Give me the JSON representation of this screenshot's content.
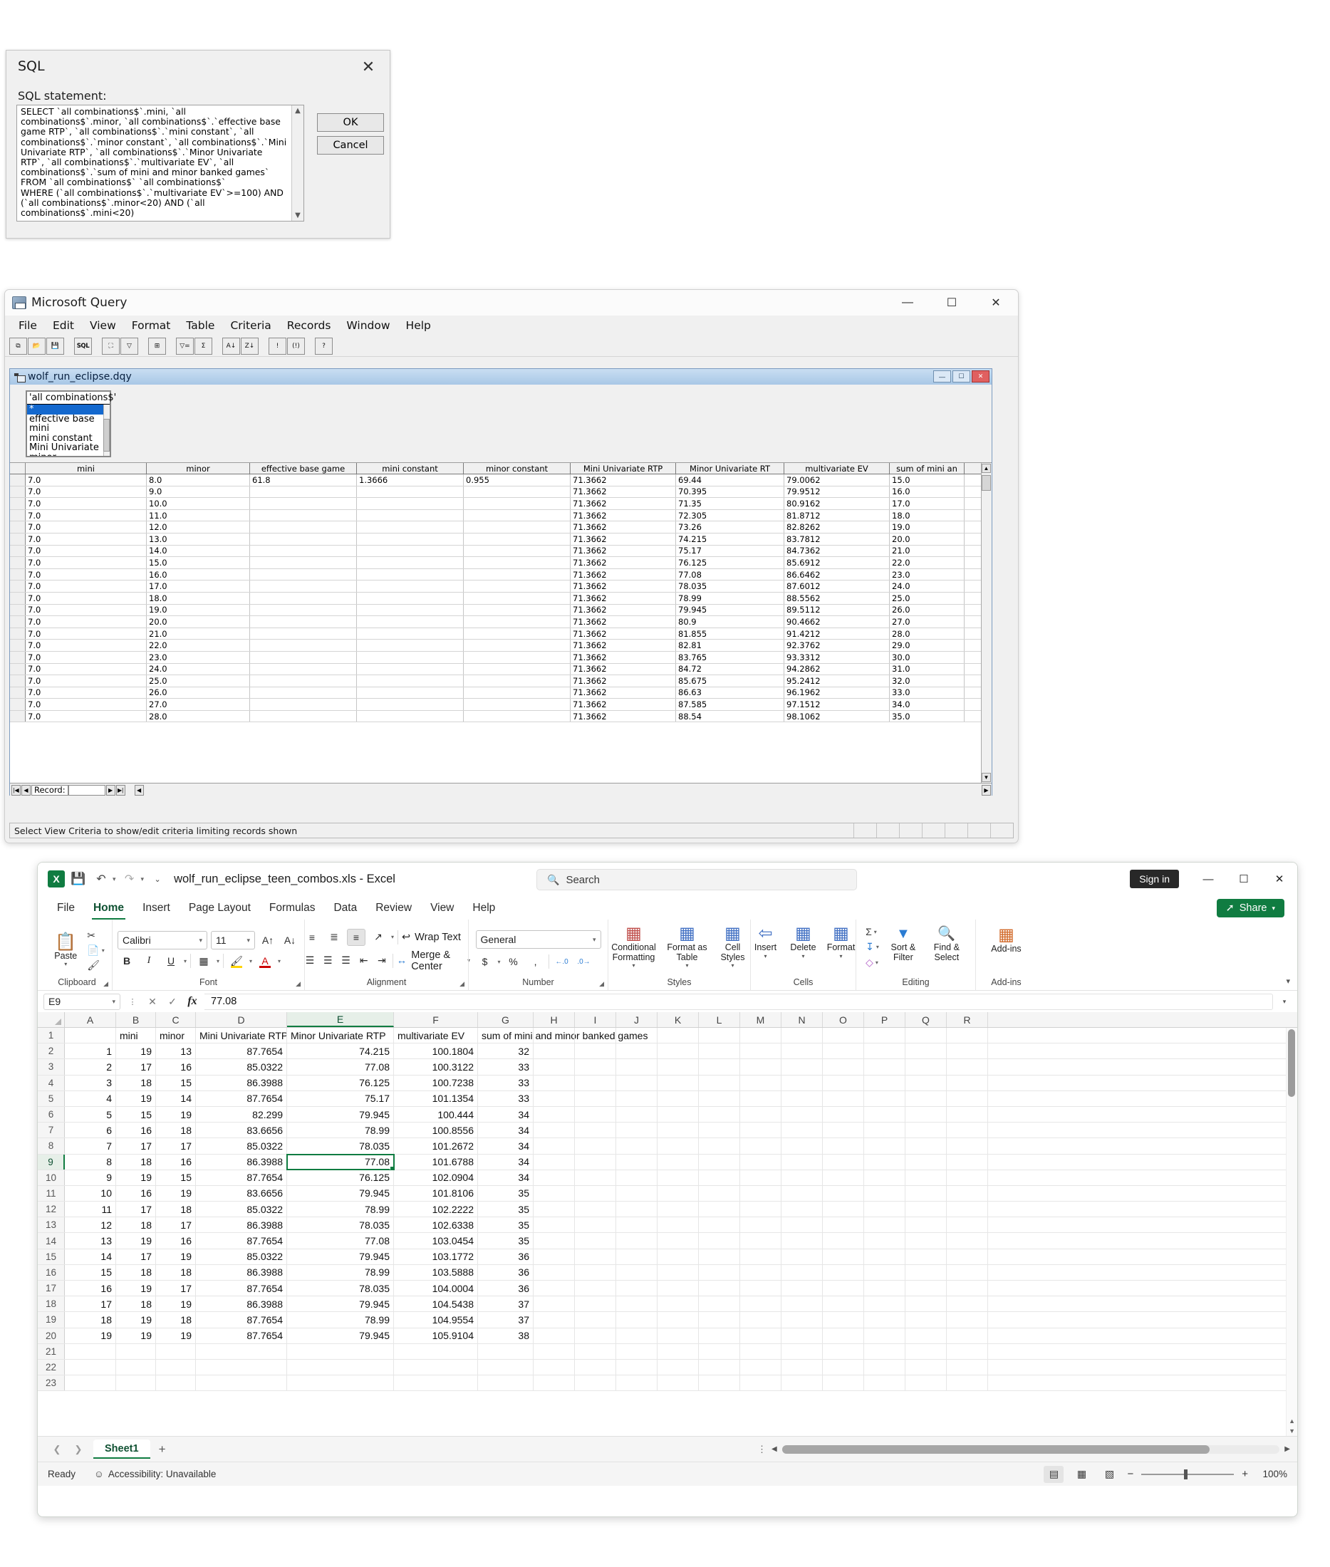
{
  "sql_dialog": {
    "title": "SQL",
    "close_icon": "close-icon",
    "statement_label": "SQL statement:",
    "statement": "SELECT `all combinations$`.mini, `all combinations$`.minor, `all combinations$`.`effective base game RTP`, `all combinations$`.`mini constant`, `all combinations$`.`minor constant`, `all combinations$`.`Mini Univariate RTP`, `all combinations$`.`Minor Univariate RTP`, `all combinations$`.`multivariate EV`, `all combinations$`.`sum of mini and minor banked games`\nFROM `all combinations$` `all combinations$`\nWHERE (`all combinations$`.`multivariate EV`>=100) AND (`all combinations$`.minor<20) AND (`all combinations$`.mini<20)",
    "ok_label": "OK",
    "cancel_label": "Cancel"
  },
  "msquery": {
    "title": "Microsoft Query",
    "menus": [
      "File",
      "Edit",
      "View",
      "Format",
      "Table",
      "Criteria",
      "Records",
      "Window",
      "Help"
    ],
    "toolbar": [
      {
        "name": "new-query-icon",
        "glyph": "⧉"
      },
      {
        "name": "open-query-icon",
        "glyph": "📂"
      },
      {
        "name": "save-query-icon",
        "glyph": "💾"
      },
      {
        "name": "sql-view-icon",
        "glyph": "SQL"
      },
      {
        "name": "show-tables-icon",
        "glyph": "⛶"
      },
      {
        "name": "show-criteria-icon",
        "glyph": "▽"
      },
      {
        "name": "add-table-icon",
        "glyph": "⊞"
      },
      {
        "name": "criteria-equals-icon",
        "glyph": "▽="
      },
      {
        "name": "cycle-totals-icon",
        "glyph": "Σ"
      },
      {
        "name": "sort-ascending-icon",
        "glyph": "A↓"
      },
      {
        "name": "sort-descending-icon",
        "glyph": "Z↓"
      },
      {
        "name": "query-now-icon",
        "glyph": "!"
      },
      {
        "name": "auto-query-icon",
        "glyph": "(!)"
      },
      {
        "name": "help-icon",
        "glyph": "?"
      }
    ],
    "window_buttons": {
      "minimize": "—",
      "maximize": "☐",
      "close": "✕"
    },
    "child_window": {
      "title": "wolf_run_eclipse.dqy",
      "buttons": {
        "minimize": "—",
        "maximize": "☐",
        "close": "✕"
      },
      "table_box": {
        "title": "'all combinations$'",
        "fields": [
          "*",
          "effective base",
          "mini",
          "mini constant",
          "Mini Univariate",
          "minor"
        ],
        "selected_index": 0
      },
      "grid": {
        "columns": [
          "mini",
          "minor",
          "effective base game",
          "mini constant",
          "minor constant",
          "Mini Univariate RTP",
          "Minor Univariate RT",
          "multivariate EV",
          "sum of mini an"
        ],
        "rows": [
          [
            "7.0",
            "8.0",
            "61.8",
            "1.3666",
            "0.955",
            "71.3662",
            "69.44",
            "79.0062",
            "15.0"
          ],
          [
            "7.0",
            "9.0",
            "",
            "",
            "",
            "71.3662",
            "70.395",
            "79.9512",
            "16.0"
          ],
          [
            "7.0",
            "10.0",
            "",
            "",
            "",
            "71.3662",
            "71.35",
            "80.9162",
            "17.0"
          ],
          [
            "7.0",
            "11.0",
            "",
            "",
            "",
            "71.3662",
            "72.305",
            "81.8712",
            "18.0"
          ],
          [
            "7.0",
            "12.0",
            "",
            "",
            "",
            "71.3662",
            "73.26",
            "82.8262",
            "19.0"
          ],
          [
            "7.0",
            "13.0",
            "",
            "",
            "",
            "71.3662",
            "74.215",
            "83.7812",
            "20.0"
          ],
          [
            "7.0",
            "14.0",
            "",
            "",
            "",
            "71.3662",
            "75.17",
            "84.7362",
            "21.0"
          ],
          [
            "7.0",
            "15.0",
            "",
            "",
            "",
            "71.3662",
            "76.125",
            "85.6912",
            "22.0"
          ],
          [
            "7.0",
            "16.0",
            "",
            "",
            "",
            "71.3662",
            "77.08",
            "86.6462",
            "23.0"
          ],
          [
            "7.0",
            "17.0",
            "",
            "",
            "",
            "71.3662",
            "78.035",
            "87.6012",
            "24.0"
          ],
          [
            "7.0",
            "18.0",
            "",
            "",
            "",
            "71.3662",
            "78.99",
            "88.5562",
            "25.0"
          ],
          [
            "7.0",
            "19.0",
            "",
            "",
            "",
            "71.3662",
            "79.945",
            "89.5112",
            "26.0"
          ],
          [
            "7.0",
            "20.0",
            "",
            "",
            "",
            "71.3662",
            "80.9",
            "90.4662",
            "27.0"
          ],
          [
            "7.0",
            "21.0",
            "",
            "",
            "",
            "71.3662",
            "81.855",
            "91.4212",
            "28.0"
          ],
          [
            "7.0",
            "22.0",
            "",
            "",
            "",
            "71.3662",
            "82.81",
            "92.3762",
            "29.0"
          ],
          [
            "7.0",
            "23.0",
            "",
            "",
            "",
            "71.3662",
            "83.765",
            "93.3312",
            "30.0"
          ],
          [
            "7.0",
            "24.0",
            "",
            "",
            "",
            "71.3662",
            "84.72",
            "94.2862",
            "31.0"
          ],
          [
            "7.0",
            "25.0",
            "",
            "",
            "",
            "71.3662",
            "85.675",
            "95.2412",
            "32.0"
          ],
          [
            "7.0",
            "26.0",
            "",
            "",
            "",
            "71.3662",
            "86.63",
            "96.1962",
            "33.0"
          ],
          [
            "7.0",
            "27.0",
            "",
            "",
            "",
            "71.3662",
            "87.585",
            "97.1512",
            "34.0"
          ],
          [
            "7.0",
            "28.0",
            "",
            "",
            "",
            "71.3662",
            "88.54",
            "98.1062",
            "35.0"
          ]
        ]
      },
      "record_nav": {
        "label": "Record:"
      }
    },
    "statusbar": "Select View Criteria to show/edit criteria limiting records shown"
  },
  "excel": {
    "document_title": "wolf_run_eclipse_teen_combos.xls  -  Excel",
    "logo_text": "X",
    "quick_access": [
      {
        "name": "save-icon",
        "glyph": "💾"
      },
      {
        "name": "undo-icon",
        "glyph": "↶"
      },
      {
        "name": "redo-icon",
        "glyph": "↷"
      },
      {
        "name": "customize-quick-access-icon",
        "glyph": "⌄"
      }
    ],
    "search": {
      "placeholder": "Search",
      "icon": "search-icon"
    },
    "sign_in_label": "Sign in",
    "window_buttons": {
      "minimize": "—",
      "maximize": "☐",
      "close": "✕"
    },
    "tabs": [
      "File",
      "Home",
      "Insert",
      "Page Layout",
      "Formulas",
      "Data",
      "Review",
      "View",
      "Help"
    ],
    "active_tab": "Home",
    "share_label": "Share",
    "ribbon": {
      "clipboard": {
        "label": "Clipboard",
        "paste_label": "Paste",
        "cut_icon": "scissors-icon",
        "copy_icon": "copy-icon",
        "format_painter_icon": "format-painter-icon"
      },
      "font": {
        "label": "Font",
        "font_name": "Calibri",
        "font_size": "11",
        "grow_icon": "increase-font-size-icon",
        "shrink_icon": "decrease-font-size-icon",
        "bold": "B",
        "italic": "I",
        "underline": "U",
        "borders_icon": "borders-icon",
        "fill_color_icon": "fill-color-icon",
        "font_color_icon": "font-color-icon"
      },
      "alignment": {
        "label": "Alignment",
        "wrap_text_label": "Wrap Text",
        "merge_center_label": "Merge & Center",
        "orientation_icon": "text-orientation-icon"
      },
      "number": {
        "label": "Number",
        "format": "General",
        "currency_icon": "currency-icon",
        "percent_icon": "percent-style-icon",
        "comma_icon": "comma-style-icon",
        "increase_decimal_icon": "increase-decimal-icon",
        "decrease_decimal_icon": "decrease-decimal-icon"
      },
      "styles": {
        "label": "Styles",
        "conditional_formatting": "Conditional\nFormatting",
        "format_as_table": "Format as\nTable",
        "cell_styles": "Cell\nStyles"
      },
      "cells": {
        "label": "Cells",
        "insert": "Insert",
        "delete": "Delete",
        "format": "Format"
      },
      "editing": {
        "label": "Editing",
        "autosum_icon": "autosum-icon",
        "fill_icon": "fill-icon",
        "clear_icon": "clear-icon",
        "sort_filter": "Sort &\nFilter",
        "find_select": "Find &\nSelect"
      },
      "addins": {
        "label": "Add-ins",
        "button_label": "Add-ins"
      }
    },
    "formula_bar": {
      "name_box": "E9",
      "cancel_icon": "cancel-entry-icon",
      "enter_icon": "confirm-entry-icon",
      "fx_icon": "insert-function-icon",
      "value": "77.08"
    },
    "sheet": {
      "columns": [
        "A",
        "B",
        "C",
        "D",
        "E",
        "F",
        "G",
        "H",
        "I",
        "J",
        "K",
        "L",
        "M",
        "N",
        "O",
        "P",
        "Q",
        "R"
      ],
      "selected_column": "E",
      "selected_row": 9,
      "active_cell": "E9",
      "header_row": {
        "row": 1,
        "cells": {
          "B": "mini",
          "C": "minor",
          "D": "Mini Univariate RTP",
          "E": "Minor Univariate RTP",
          "F": "multivariate EV",
          "G": "sum of mini and minor banked games"
        }
      },
      "rows": [
        {
          "row": 2,
          "A": "1",
          "B": "19",
          "C": "13",
          "D": "87.7654",
          "E": "74.215",
          "F": "100.1804",
          "G": "32"
        },
        {
          "row": 3,
          "A": "2",
          "B": "17",
          "C": "16",
          "D": "85.0322",
          "E": "77.08",
          "F": "100.3122",
          "G": "33"
        },
        {
          "row": 4,
          "A": "3",
          "B": "18",
          "C": "15",
          "D": "86.3988",
          "E": "76.125",
          "F": "100.7238",
          "G": "33"
        },
        {
          "row": 5,
          "A": "4",
          "B": "19",
          "C": "14",
          "D": "87.7654",
          "E": "75.17",
          "F": "101.1354",
          "G": "33"
        },
        {
          "row": 6,
          "A": "5",
          "B": "15",
          "C": "19",
          "D": "82.299",
          "E": "79.945",
          "F": "100.444",
          "G": "34"
        },
        {
          "row": 7,
          "A": "6",
          "B": "16",
          "C": "18",
          "D": "83.6656",
          "E": "78.99",
          "F": "100.8556",
          "G": "34"
        },
        {
          "row": 8,
          "A": "7",
          "B": "17",
          "C": "17",
          "D": "85.0322",
          "E": "78.035",
          "F": "101.2672",
          "G": "34"
        },
        {
          "row": 9,
          "A": "8",
          "B": "18",
          "C": "16",
          "D": "86.3988",
          "E": "77.08",
          "F": "101.6788",
          "G": "34"
        },
        {
          "row": 10,
          "A": "9",
          "B": "19",
          "C": "15",
          "D": "87.7654",
          "E": "76.125",
          "F": "102.0904",
          "G": "34"
        },
        {
          "row": 11,
          "A": "10",
          "B": "16",
          "C": "19",
          "D": "83.6656",
          "E": "79.945",
          "F": "101.8106",
          "G": "35"
        },
        {
          "row": 12,
          "A": "11",
          "B": "17",
          "C": "18",
          "D": "85.0322",
          "E": "78.99",
          "F": "102.2222",
          "G": "35"
        },
        {
          "row": 13,
          "A": "12",
          "B": "18",
          "C": "17",
          "D": "86.3988",
          "E": "78.035",
          "F": "102.6338",
          "G": "35"
        },
        {
          "row": 14,
          "A": "13",
          "B": "19",
          "C": "16",
          "D": "87.7654",
          "E": "77.08",
          "F": "103.0454",
          "G": "35"
        },
        {
          "row": 15,
          "A": "14",
          "B": "17",
          "C": "19",
          "D": "85.0322",
          "E": "79.945",
          "F": "103.1772",
          "G": "36"
        },
        {
          "row": 16,
          "A": "15",
          "B": "18",
          "C": "18",
          "D": "86.3988",
          "E": "78.99",
          "F": "103.5888",
          "G": "36"
        },
        {
          "row": 17,
          "A": "16",
          "B": "19",
          "C": "17",
          "D": "87.7654",
          "E": "78.035",
          "F": "104.0004",
          "G": "36"
        },
        {
          "row": 18,
          "A": "17",
          "B": "18",
          "C": "19",
          "D": "86.3988",
          "E": "79.945",
          "F": "104.5438",
          "G": "37"
        },
        {
          "row": 19,
          "A": "18",
          "B": "19",
          "C": "18",
          "D": "87.7654",
          "E": "78.99",
          "F": "104.9554",
          "G": "37"
        },
        {
          "row": 20,
          "A": "19",
          "B": "19",
          "C": "19",
          "D": "87.7654",
          "E": "79.945",
          "F": "105.9104",
          "G": "38"
        },
        {
          "row": 21,
          "A": "",
          "B": "",
          "C": "",
          "D": "",
          "E": "",
          "F": "",
          "G": ""
        },
        {
          "row": 22,
          "A": "",
          "B": "",
          "C": "",
          "D": "",
          "E": "",
          "F": "",
          "G": ""
        },
        {
          "row": 23,
          "A": "",
          "B": "",
          "C": "",
          "D": "",
          "E": "",
          "F": "",
          "G": ""
        }
      ]
    },
    "sheet_tabs": {
      "sheets": [
        "Sheet1"
      ],
      "active": "Sheet1",
      "add_label": "+"
    },
    "status": {
      "ready": "Ready",
      "accessibility": "Accessibility: Unavailable",
      "views": [
        {
          "name": "normal-view-icon",
          "glyph": "▒",
          "active": true
        },
        {
          "name": "page-layout-view-icon",
          "glyph": "▤",
          "active": false
        },
        {
          "name": "page-break-preview-icon",
          "glyph": "▧",
          "active": false
        }
      ],
      "zoom_out": "−",
      "zoom_in": "+",
      "zoom_level": "100%"
    }
  }
}
